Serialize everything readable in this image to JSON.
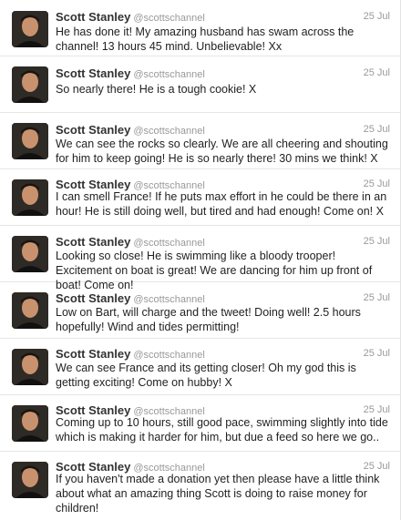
{
  "tweets": [
    {
      "name": "Scott Stanley",
      "handle": "@scottschannel",
      "time": "25 Jul",
      "text": "He has done it! My amazing husband has swam across the channel! 13 hours 45 mind. Unbelievable! Xx"
    },
    {
      "name": "Scott Stanley",
      "handle": "@scottschannel",
      "time": "25 Jul",
      "text": "So nearly there! He is a tough cookie! X"
    },
    {
      "name": "Scott Stanley",
      "handle": "@scottschannel",
      "time": "25 Jul",
      "text": "We can see the rocks so clearly. We are all cheering and shouting for him to keep going! He is so nearly there! 30 mins we think! X"
    },
    {
      "name": "Scott Stanley",
      "handle": "@scottschannel",
      "time": "25 Jul",
      "text": "I can smell France! If he puts max effort in he could be there in an hour! He is still doing well, but tired and had enough! Come on! X"
    },
    {
      "name": "Scott Stanley",
      "handle": "@scottschannel",
      "time": "25 Jul",
      "text": "Looking so close! He is swimming like a bloody trooper! Excitement on boat is great! We are dancing for him up front of boat! Come on!"
    },
    {
      "name": "Scott Stanley",
      "handle": "@scottschannel",
      "time": "25 Jul",
      "text": "Low on Bart, will charge and the tweet! Doing well! 2.5 hours hopefully! Wind and tides permitting!"
    },
    {
      "name": "Scott Stanley",
      "handle": "@scottschannel",
      "time": "25 Jul",
      "text": "We can see France and its getting closer! Oh my god this is getting exciting! Come on hubby! X"
    },
    {
      "name": "Scott Stanley",
      "handle": "@scottschannel",
      "time": "25 Jul",
      "text": "Coming up to 10 hours, still good pace, swimming slightly into tide which is making it harder for him, but due a feed so here we go.."
    },
    {
      "name": "Scott Stanley",
      "handle": "@scottschannel",
      "time": "25 Jul",
      "text": "If you haven't made a donation yet then please have a little think about what an amazing thing Scott is doing to raise money for children!"
    }
  ]
}
